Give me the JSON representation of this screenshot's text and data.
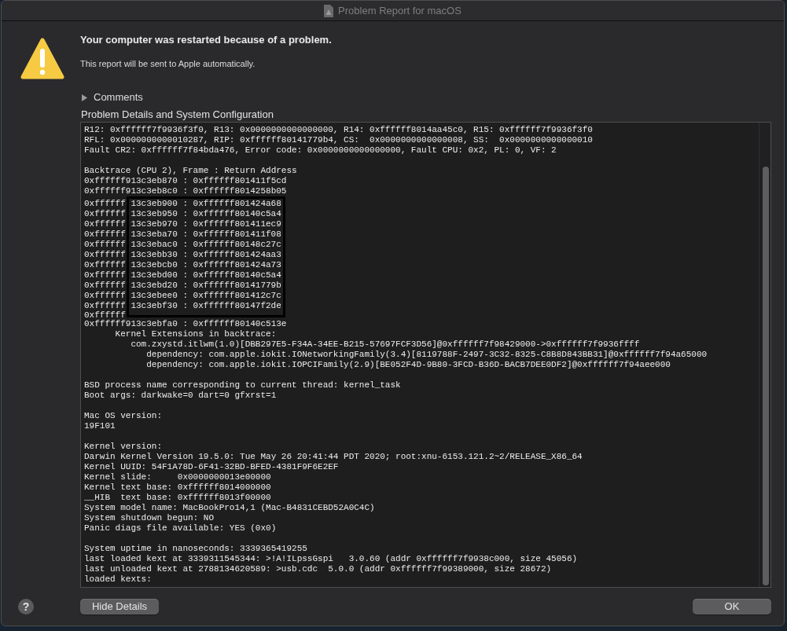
{
  "window": {
    "title": "Problem Report for macOS"
  },
  "alert": {
    "heading": "Your computer was restarted because of a problem.",
    "message": "This report will be sent to Apple automatically."
  },
  "comments": {
    "label": "Comments",
    "expanded": false
  },
  "details": {
    "label": "Problem Details and System Configuration",
    "log": [
      {
        "kind": "lines",
        "lines": [
          "R12: 0xffffff7f9936f3f0, R13: 0x0000000000000000, R14: 0xffffff8014aa45c0, R15: 0xffffff7f9936f3f0",
          "RFL: 0x0000000000010287, RIP: 0xffffff80141779b4, CS:  0x0000000000000008, SS:  0x0000000000000010",
          "Fault CR2: 0xffffff7f84bda476, Error code: 0x0000000000000000, Fault CPU: 0x2, PL: 0, VF: 2"
        ]
      },
      {
        "kind": "blank"
      },
      {
        "kind": "lines",
        "lines": [
          "Backtrace (CPU 2), Frame : Return Address",
          "0xffffff913c3eb870 : 0xffffff801411f5cd",
          "0xffffff913c3eb8c0 : 0xffffff8014258b05"
        ]
      },
      {
        "kind": "overdrawn",
        "rows": [
          {
            "left": "0xffffff",
            "right": "13c3eb900 : 0xffffff801424a68"
          },
          {
            "left": "0xffffff",
            "right": "13c3eb950 : 0xffffff80140c5a4"
          },
          {
            "left": "0xffffff",
            "right": "13c3eb970 : 0xffffff801411ec9"
          },
          {
            "left": "0xffffff",
            "right": "13c3eba70 : 0xffffff801411f08"
          },
          {
            "left": "0xffffff",
            "right": "13c3ebac0 : 0xffffff80148c27c"
          },
          {
            "left": "0xffffff",
            "right": "13c3ebb30 : 0xffffff801424aa3"
          },
          {
            "left": "0xffffff",
            "right": "13c3ebcb0 : 0xffffff801424a73"
          },
          {
            "left": "0xffffff",
            "right": "13c3ebd00 : 0xffffff80140c5a4"
          },
          {
            "left": "0xffffff",
            "right": "13c3ebd20 : 0xffffff80141779b"
          },
          {
            "left": "0xffffff",
            "right": "13c3ebee0 : 0xffffff801412c7c"
          },
          {
            "left": "0xffffff",
            "right": "13c3ebf30 : 0xffffff80147f2de"
          },
          {
            "left": "0xffffff"
          }
        ]
      },
      {
        "kind": "lines",
        "lines": [
          "0xffffff913c3ebfa0 : 0xffffff80140c513e",
          "      Kernel Extensions in backtrace:",
          "         com.zxystd.itlwm(1.0)[DBB297E5-F34A-34EE-B215-57697FCF3D56]@0xffffff7f98429000->0xffffff7f9936ffff",
          "            dependency: com.apple.iokit.IONetworkingFamily(3.4)[8119788F-2497-3C32-8325-C8B8D843BB31]@0xffffff7f94a65000",
          "            dependency: com.apple.iokit.IOPCIFamily(2.9)[BE052F4D-9B80-3FCD-B36D-BACB7DEE0DF2]@0xffffff7f94aee000"
        ]
      },
      {
        "kind": "blank"
      },
      {
        "kind": "lines",
        "lines": [
          "BSD process name corresponding to current thread: kernel_task",
          "Boot args: darkwake=0 dart=0 gfxrst=1"
        ]
      },
      {
        "kind": "blank"
      },
      {
        "kind": "lines",
        "lines": [
          "Mac OS version:",
          "19F101"
        ]
      },
      {
        "kind": "blank"
      },
      {
        "kind": "lines",
        "lines": [
          "Kernel version:",
          "Darwin Kernel Version 19.5.0: Tue May 26 20:41:44 PDT 2020; root:xnu-6153.121.2~2/RELEASE_X86_64",
          "Kernel UUID: 54F1A78D-6F41-32BD-BFED-4381F9F6E2EF",
          "Kernel slide:     0x0000000013e00000",
          "Kernel text base: 0xffffff8014000000",
          "__HIB  text base: 0xffffff8013f00000",
          "System model name: MacBookPro14,1 (Mac-B4831CEBD52A0C4C)",
          "System shutdown begun: NO",
          "Panic diags file available: YES (0x0)"
        ]
      },
      {
        "kind": "blank"
      },
      {
        "kind": "lines",
        "lines": [
          "System uptime in nanoseconds: 3339365419255",
          "last loaded kext at 3339311545344: >!A!ILpssGspi   3.0.60 (addr 0xffffff7f9938c000, size 45056)",
          "last unloaded kext at 2788134620589: >usb.cdc  5.0.0 (addr 0xffffff7f99389000, size 28672)",
          "loaded kexts:"
        ]
      }
    ]
  },
  "help": "?",
  "buttons": [
    "Hide Details",
    "OK"
  ]
}
